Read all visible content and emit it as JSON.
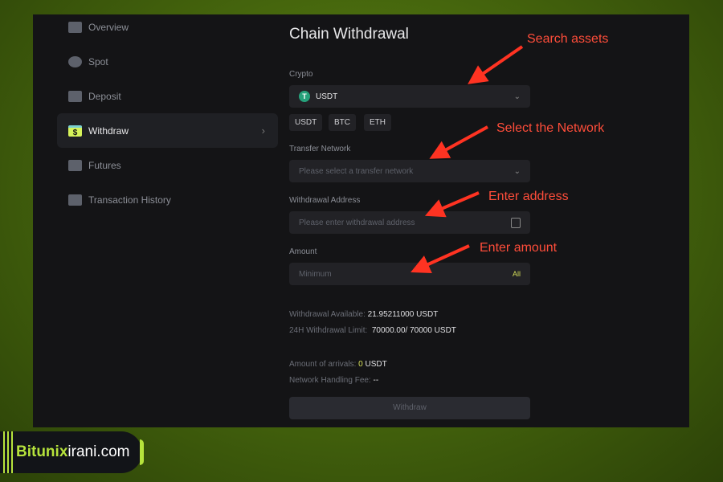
{
  "sidebar": {
    "items": [
      {
        "label": "Overview",
        "icon": "overview-icon"
      },
      {
        "label": "Spot",
        "icon": "coins-icon"
      },
      {
        "label": "Deposit",
        "icon": "deposit-icon"
      },
      {
        "label": "Withdraw",
        "icon": "withdraw-icon",
        "active": true
      },
      {
        "label": "Futures",
        "icon": "futures-icon"
      },
      {
        "label": "Transaction History",
        "icon": "history-icon"
      }
    ]
  },
  "main": {
    "title": "Chain Withdrawal",
    "crypto_label": "Crypto",
    "crypto_value": "USDT",
    "crypto_icon_glyph": "T",
    "quick": [
      "USDT",
      "BTC",
      "ETH"
    ],
    "network_label": "Transfer Network",
    "network_placeholder": "Please select a transfer network",
    "address_label": "Withdrawal Address",
    "address_placeholder": "Please enter withdrawal address",
    "amount_label": "Amount",
    "amount_placeholder": "Minimum",
    "all_label": "All",
    "available_label": "Withdrawal Available:",
    "available_value": "21.95211000 USDT",
    "limit_label": "24H Withdrawal Limit:",
    "limit_value": "70000.00/ 70000 USDT",
    "arrivals_label": "Amount of arrivals:",
    "arrivals_value": "0",
    "arrivals_unit": "USDT",
    "fee_label": "Network Handling Fee:",
    "fee_value": "--",
    "withdraw_button": "Withdraw"
  },
  "annotations": [
    "Search assets",
    "Select the Network",
    "Enter address",
    "Enter amount"
  ],
  "annotation_color": "#ff4d3a",
  "logo": {
    "bold": "Bitunix",
    "rest": "irani.com"
  }
}
